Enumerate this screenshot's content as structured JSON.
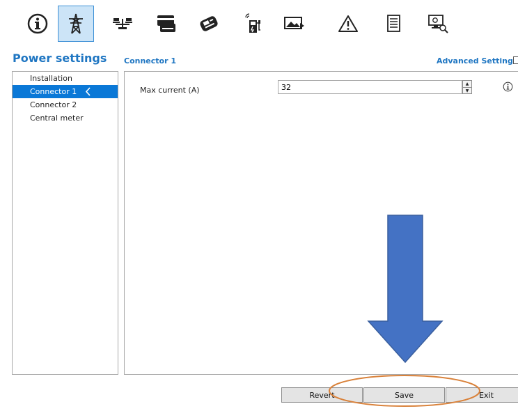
{
  "toolbar": {
    "items": [
      {
        "icon": "info-icon",
        "active": false
      },
      {
        "icon": "power-pylon-icon",
        "active": true
      },
      {
        "icon": "balance-scale-icon",
        "active": false
      },
      {
        "icon": "payment-card-reader-icon",
        "active": false
      },
      {
        "icon": "payment-terminal-icon",
        "active": false
      },
      {
        "icon": "charging-station-icon",
        "active": false
      },
      {
        "icon": "display-image-icon",
        "active": false
      },
      {
        "icon": "warning-icon",
        "active": false
      },
      {
        "icon": "document-icon",
        "active": false
      },
      {
        "icon": "monitor-search-icon",
        "active": false
      }
    ]
  },
  "page": {
    "title": "Power settings",
    "section_title": "Connector 1",
    "advanced_settings_label": "Advanced Settings"
  },
  "sidebar": {
    "items": [
      {
        "label": "Installation",
        "selected": false
      },
      {
        "label": "Connector 1",
        "selected": true
      },
      {
        "label": "Connector 2",
        "selected": false
      },
      {
        "label": "Central meter",
        "selected": false
      }
    ]
  },
  "form": {
    "max_current_label": "Max current (A)",
    "max_current_value": "32"
  },
  "buttons": {
    "revert": "Revert",
    "save": "Save",
    "exit": "Exit"
  },
  "colors": {
    "accent": "#1f76c2",
    "selection": "#0a78d7",
    "arrow_fill": "#4472c4",
    "highlight_ring": "#d9823b"
  }
}
